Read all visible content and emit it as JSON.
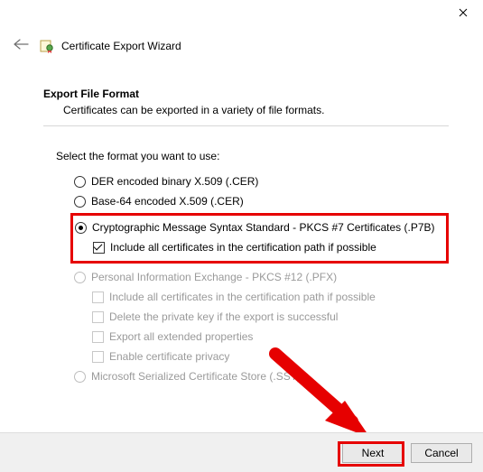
{
  "window": {
    "title": "Certificate Export Wizard"
  },
  "page": {
    "heading": "Export File Format",
    "subheading": "Certificates can be exported in a variety of file formats.",
    "instruction": "Select the format you want to use:"
  },
  "options": {
    "der": {
      "label": "DER encoded binary X.509 (.CER)"
    },
    "base64": {
      "label": "Base-64 encoded X.509 (.CER)"
    },
    "p7b": {
      "label": "Cryptographic Message Syntax Standard - PKCS #7 Certificates (.P7B)",
      "include_chain": "Include all certificates in the certification path if possible"
    },
    "pfx": {
      "label": "Personal Information Exchange - PKCS #12 (.PFX)",
      "include_chain": "Include all certificates in the certification path if possible",
      "delete_key": "Delete the private key if the export is successful",
      "export_ext": "Export all extended properties",
      "cert_privacy": "Enable certificate privacy"
    },
    "sst": {
      "label": "Microsoft Serialized Certificate Store (.SST)"
    }
  },
  "buttons": {
    "next": "Next",
    "cancel": "Cancel"
  }
}
